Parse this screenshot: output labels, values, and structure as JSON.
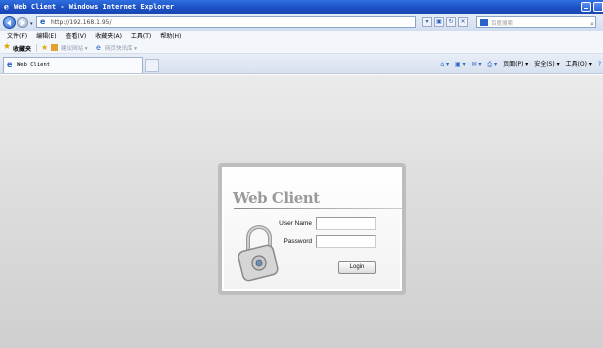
{
  "window": {
    "title": "Web Client - Windows Internet Explorer"
  },
  "address_bar": {
    "url": "http://192.168.1.95/",
    "search_placeholder": "百度搜索"
  },
  "menu": {
    "items": [
      "文件(F)",
      "编辑(E)",
      "查看(V)",
      "收藏夹(A)",
      "工具(T)",
      "帮助(H)"
    ]
  },
  "favorites_bar": {
    "label": "收藏夹",
    "suggested": "建议网站 ▾",
    "web_slice": "网页快讯库 ▾"
  },
  "tab": {
    "label": "Web Client"
  },
  "command_bar": {
    "items": [
      "页面(P) ▾",
      "安全(S) ▾",
      "工具(O) ▾"
    ]
  },
  "login": {
    "brand": "Web Client",
    "username_label": "User Name",
    "password_label": "Password",
    "username_value": "",
    "password_value": "",
    "button_label": "Login"
  },
  "colors": {
    "titlebar": "#1b4fc2",
    "page_background": "#dedede",
    "frame_border": "#bdbdbd"
  }
}
